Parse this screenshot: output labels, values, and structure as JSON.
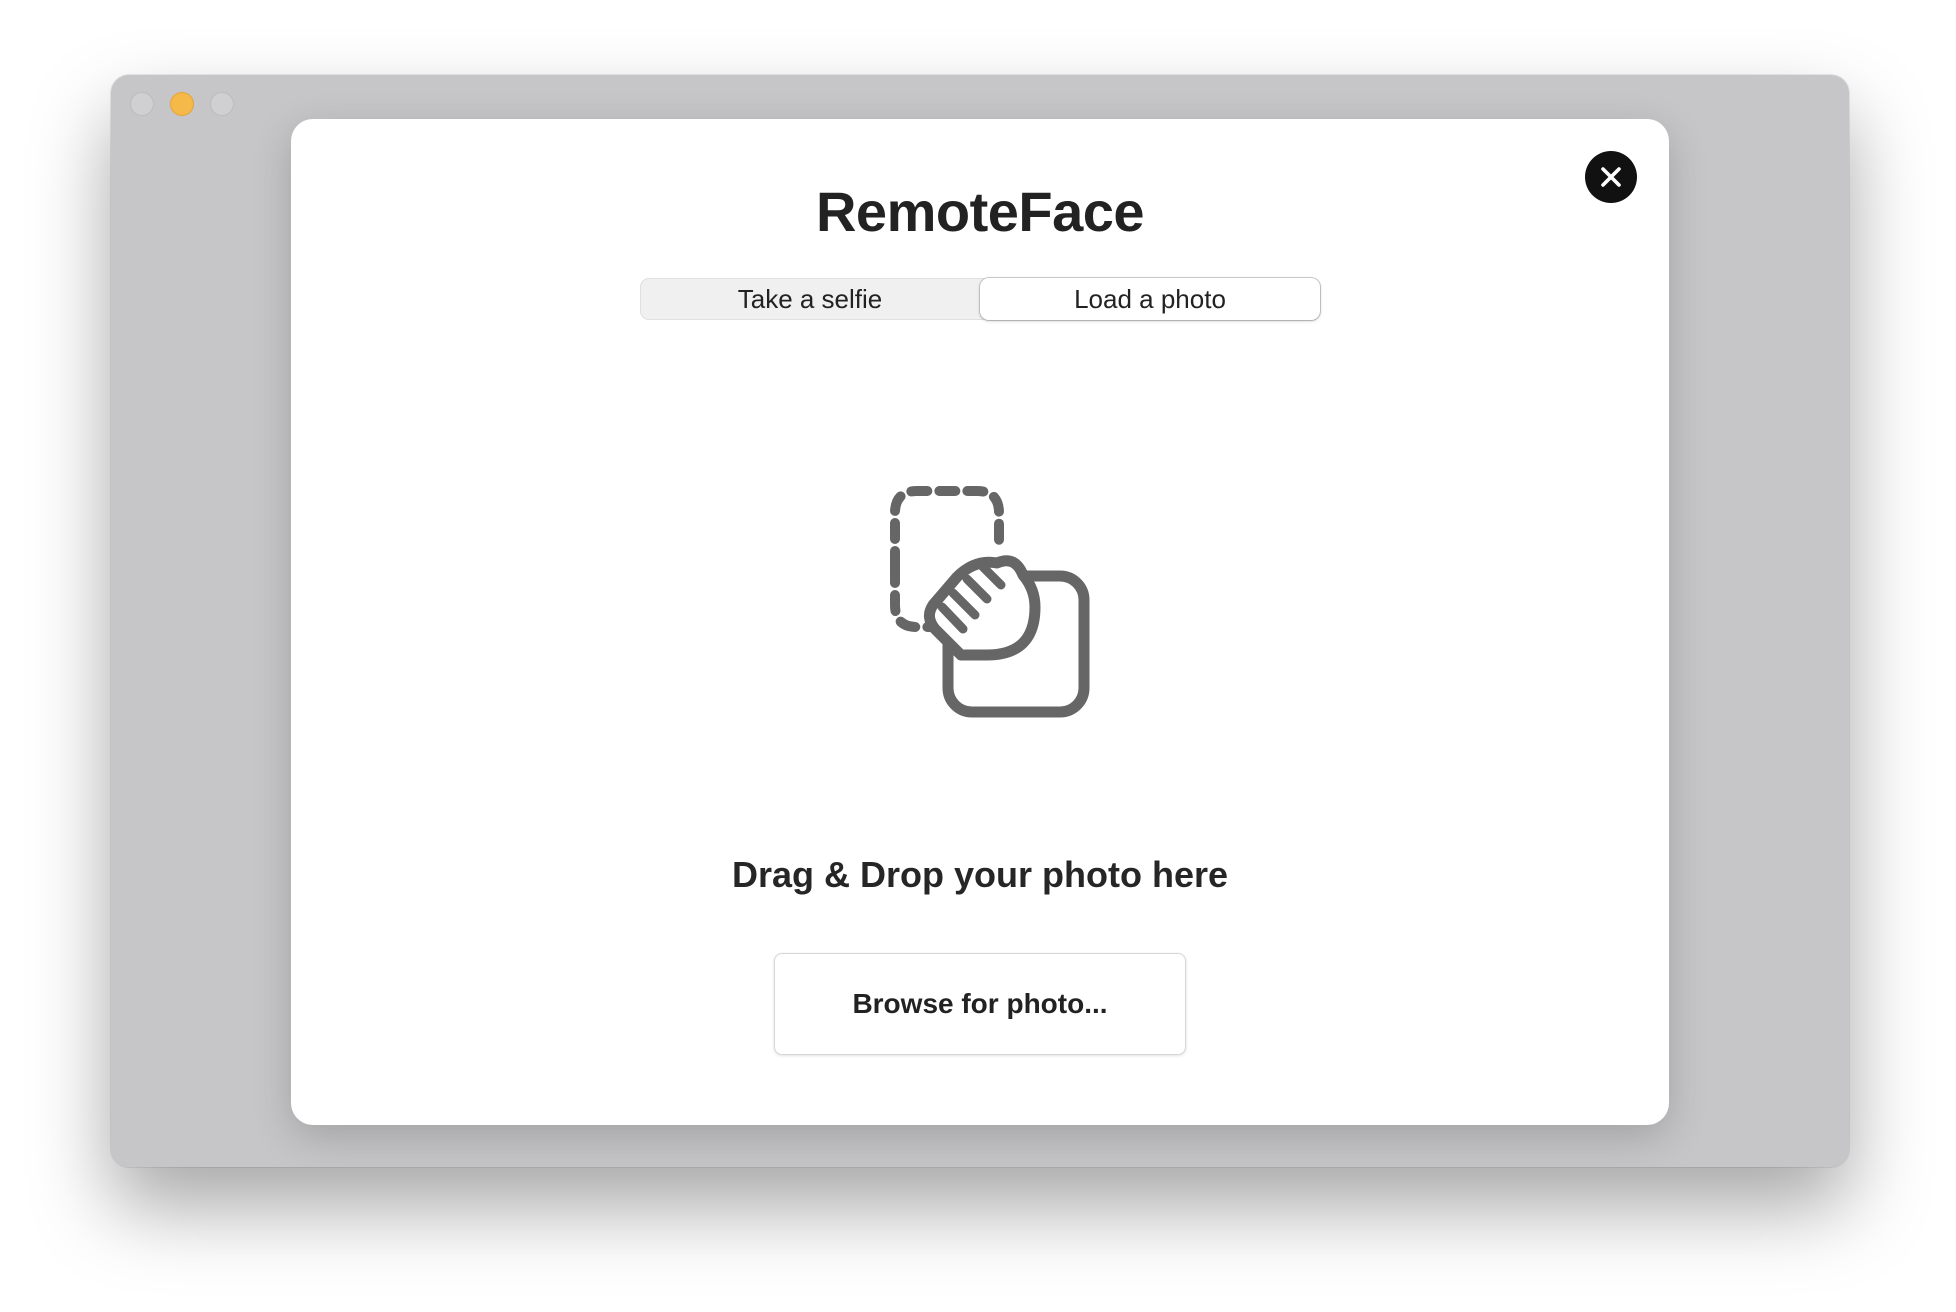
{
  "window": {
    "traffic_lights": [
      "close",
      "minimize",
      "zoom"
    ]
  },
  "modal": {
    "title": "RemoteFace",
    "close_icon": "close-x-icon",
    "tabs": [
      {
        "label": "Take a selfie",
        "selected": false
      },
      {
        "label": "Load a photo",
        "selected": true
      }
    ],
    "illustration_icon": "drag-drop-photo-icon",
    "drop_text": "Drag & Drop your photo here",
    "browse_label": "Browse for photo..."
  },
  "colors": {
    "window_bg": "#c6c6c8",
    "modal_bg": "#ffffff",
    "close_button_bg": "#111111",
    "illustration_stroke": "#666666",
    "minimize_light": "#f5b94a"
  }
}
